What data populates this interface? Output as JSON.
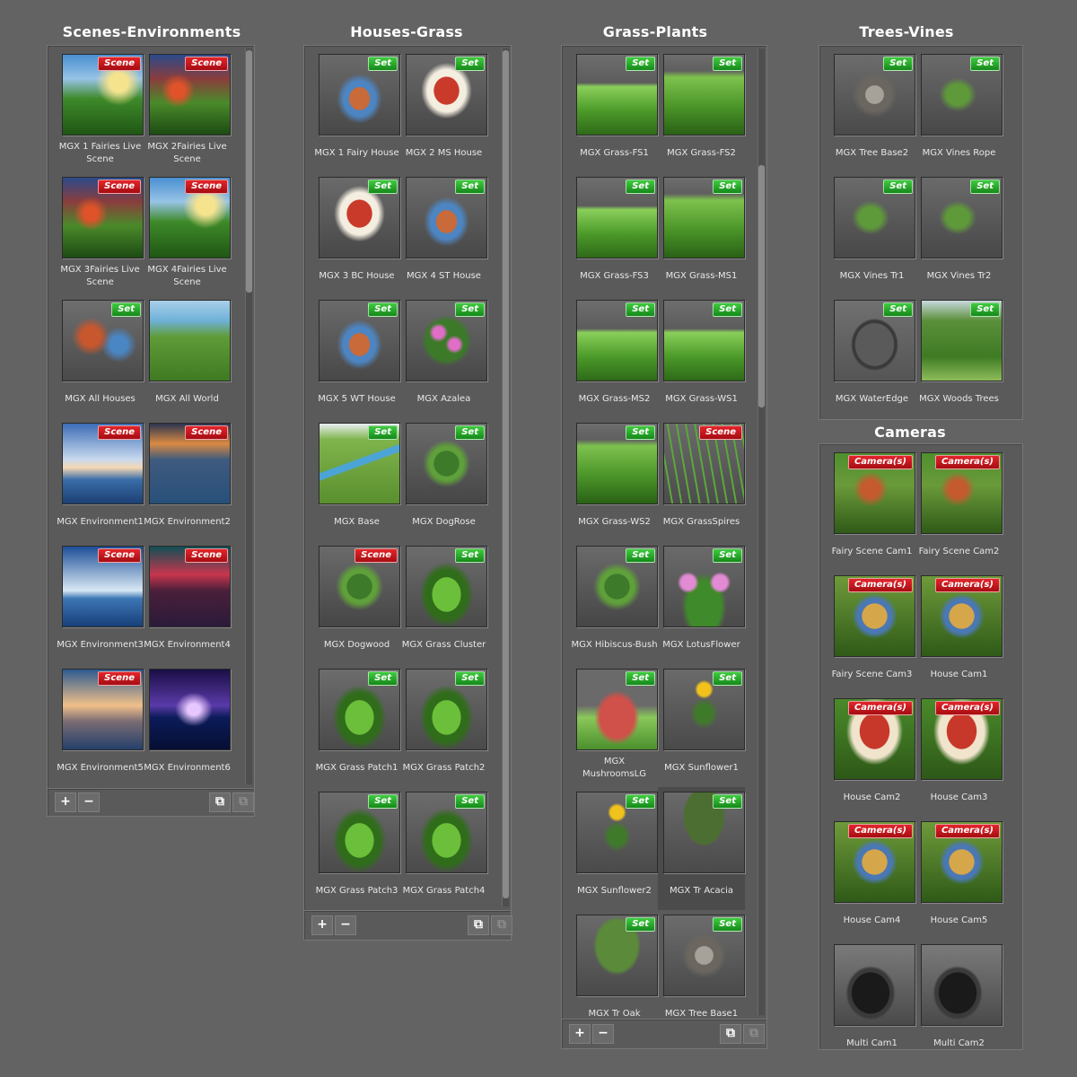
{
  "panels": [
    {
      "title": "Scenes-Environments",
      "items": [
        {
          "label": "MGX 1 Fairies Live Scene",
          "badge": "Scene",
          "look": "scene"
        },
        {
          "label": "MGX 2Fairies Live Scene",
          "badge": "Scene",
          "look": "scene2"
        },
        {
          "label": "MGX 3Fairies Live Scene",
          "badge": "Scene",
          "look": "scene2"
        },
        {
          "label": "MGX 4Fairies Live Scene",
          "badge": "Scene",
          "look": "scene"
        },
        {
          "label": "MGX All Houses",
          "badge": "Set",
          "look": "houses"
        },
        {
          "label": "MGX All World",
          "badge": "",
          "look": "world"
        },
        {
          "label": "MGX Environment1",
          "badge": "Scene",
          "look": "env1"
        },
        {
          "label": "MGX Environment2",
          "badge": "Scene",
          "look": "env2"
        },
        {
          "label": "MGX Environment3",
          "badge": "Scene",
          "look": "env3"
        },
        {
          "label": "MGX Environment4",
          "badge": "Scene",
          "look": "env4"
        },
        {
          "label": "MGX Environment5",
          "badge": "Scene",
          "look": "env5"
        },
        {
          "label": "MGX Environment6",
          "badge": "",
          "look": "env6"
        }
      ],
      "buttons": {
        "add": "+",
        "remove": "−"
      }
    },
    {
      "title": "Houses-Grass",
      "items": [
        {
          "label": "MGX 1 Fairy House",
          "badge": "Set",
          "look": "house"
        },
        {
          "label": "MGX 2 MS House",
          "badge": "Set",
          "look": "mush"
        },
        {
          "label": "MGX 3 BC House",
          "badge": "Set",
          "look": "mush"
        },
        {
          "label": "MGX 4 ST House",
          "badge": "Set",
          "look": "house"
        },
        {
          "label": "MGX 5 WT House",
          "badge": "Set",
          "look": "house"
        },
        {
          "label": "MGX Azalea",
          "badge": "Set",
          "look": "azalea"
        },
        {
          "label": "MGX Base",
          "badge": "Set",
          "look": "base"
        },
        {
          "label": "MGX DogRose",
          "badge": "Set",
          "look": "plant"
        },
        {
          "label": "MGX Dogwood",
          "badge": "Scene",
          "look": "plant"
        },
        {
          "label": "MGX Grass Cluster",
          "badge": "Set",
          "look": "grasspatch"
        },
        {
          "label": "MGX Grass Patch1",
          "badge": "Set",
          "look": "grasspatch"
        },
        {
          "label": "MGX Grass Patch2",
          "badge": "Set",
          "look": "grasspatch"
        },
        {
          "label": "MGX Grass Patch3",
          "badge": "Set",
          "look": "grasspatch"
        },
        {
          "label": "MGX Grass Patch4",
          "badge": "Set",
          "look": "grasspatch"
        }
      ],
      "buttons": {
        "add": "+",
        "remove": "−"
      }
    },
    {
      "title": "Grass-Plants",
      "items": [
        {
          "label": "MGX Grass-FS1",
          "badge": "Set",
          "look": "grass"
        },
        {
          "label": "MGX Grass-FS2",
          "badge": "Set",
          "look": "grass2"
        },
        {
          "label": "MGX Grass-FS3",
          "badge": "Set",
          "look": "grass"
        },
        {
          "label": "MGX Grass-MS1",
          "badge": "Set",
          "look": "grass2"
        },
        {
          "label": "MGX Grass-MS2",
          "badge": "Set",
          "look": "grass"
        },
        {
          "label": "MGX Grass-WS1",
          "badge": "Set",
          "look": "grass"
        },
        {
          "label": "MGX Grass-WS2",
          "badge": "Set",
          "look": "grass2"
        },
        {
          "label": "MGX GrassSpires",
          "badge": "Scene",
          "look": "spires"
        },
        {
          "label": "MGX Hibiscus-Bush",
          "badge": "Set",
          "look": "plant"
        },
        {
          "label": "MGX LotusFlower",
          "badge": "Set",
          "look": "lotus"
        },
        {
          "label": "MGX MushroomsLG",
          "badge": "Set",
          "look": "mushrooms"
        },
        {
          "label": "MGX Sunflower1",
          "badge": "Set",
          "look": "sunflower"
        },
        {
          "label": "MGX Sunflower2",
          "badge": "Set",
          "look": "sunflower"
        },
        {
          "label": "MGX Tr Acacia",
          "badge": "Set",
          "look": "acacia"
        },
        {
          "label": "MGX Tr Oak",
          "badge": "Set",
          "look": "oak"
        },
        {
          "label": "MGX Tree Base1",
          "badge": "Set",
          "look": "treebase"
        }
      ],
      "buttons": {
        "add": "+",
        "remove": "−"
      }
    },
    {
      "title": "Trees-Vines",
      "items": [
        {
          "label": "MGX Tree Base2",
          "badge": "Set",
          "look": "treebase"
        },
        {
          "label": "MGX Vines Rope",
          "badge": "Set",
          "look": "vines"
        },
        {
          "label": "MGX Vines Tr1",
          "badge": "Set",
          "look": "vines"
        },
        {
          "label": "MGX Vines Tr2",
          "badge": "Set",
          "look": "vines"
        },
        {
          "label": "MGX WaterEdge",
          "badge": "Set",
          "look": "water"
        },
        {
          "label": "MGX Woods Trees",
          "badge": "Set",
          "look": "woods"
        }
      ]
    },
    {
      "title": "Cameras",
      "items": [
        {
          "label": "Fairy Scene Cam1",
          "badge": "Camera(s)",
          "look": "camscene"
        },
        {
          "label": "Fairy Scene Cam2",
          "badge": "Camera(s)",
          "look": "camscene"
        },
        {
          "label": "Fairy Scene Cam3",
          "badge": "Camera(s)",
          "look": "camhouse"
        },
        {
          "label": "House Cam1",
          "badge": "Camera(s)",
          "look": "camhouse"
        },
        {
          "label": "House Cam2",
          "badge": "Camera(s)",
          "look": "cammush"
        },
        {
          "label": "House Cam3",
          "badge": "Camera(s)",
          "look": "cammush"
        },
        {
          "label": "House Cam4",
          "badge": "Camera(s)",
          "look": "camhouse"
        },
        {
          "label": "House Cam5",
          "badge": "Camera(s)",
          "look": "camhouse"
        },
        {
          "label": "Multi Cam1",
          "badge": "",
          "look": "camera"
        },
        {
          "label": "Multi Cam2",
          "badge": "",
          "look": "camera"
        }
      ]
    }
  ],
  "colors": {
    "scene_badge": "#c8161c",
    "set_badge": "#24a82a",
    "panel_bg": "#5a5a5a",
    "page_bg": "#636363"
  },
  "icons": {
    "copy": "copy-icon",
    "paste": "paste-icon"
  }
}
